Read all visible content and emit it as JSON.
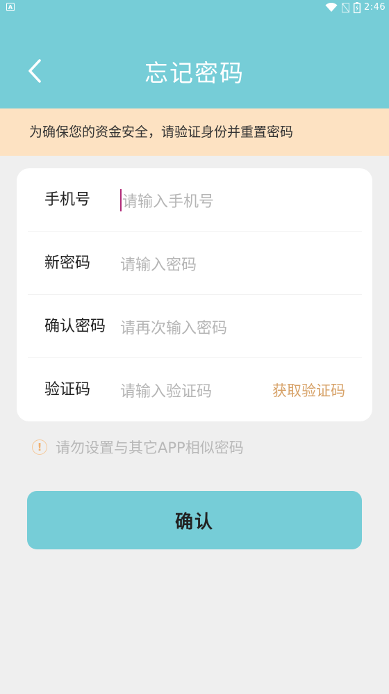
{
  "status_bar": {
    "time": "2:46",
    "app_icon": "A"
  },
  "header": {
    "title": "忘记密码",
    "back_icon": "chevron-left-icon"
  },
  "notice": "为确保您的资金安全，请验证身份并重置密码",
  "form": {
    "phone": {
      "label": "手机号",
      "placeholder": "请输入手机号"
    },
    "new_password": {
      "label": "新密码",
      "placeholder": "请输入密码"
    },
    "confirm_password": {
      "label": "确认密码",
      "placeholder": "请再次输入密码"
    },
    "code": {
      "label": "验证码",
      "placeholder": "请输入验证码",
      "get_code": "获取验证码"
    }
  },
  "tip": {
    "icon": "!",
    "text": "请勿设置与其它APP相似密码"
  },
  "submit_label": "确认",
  "colors": {
    "primary": "#76cdd7",
    "notice_bg": "#fde2c2",
    "link": "#d7a268",
    "cursor": "#b02a78",
    "background": "#efefef"
  }
}
